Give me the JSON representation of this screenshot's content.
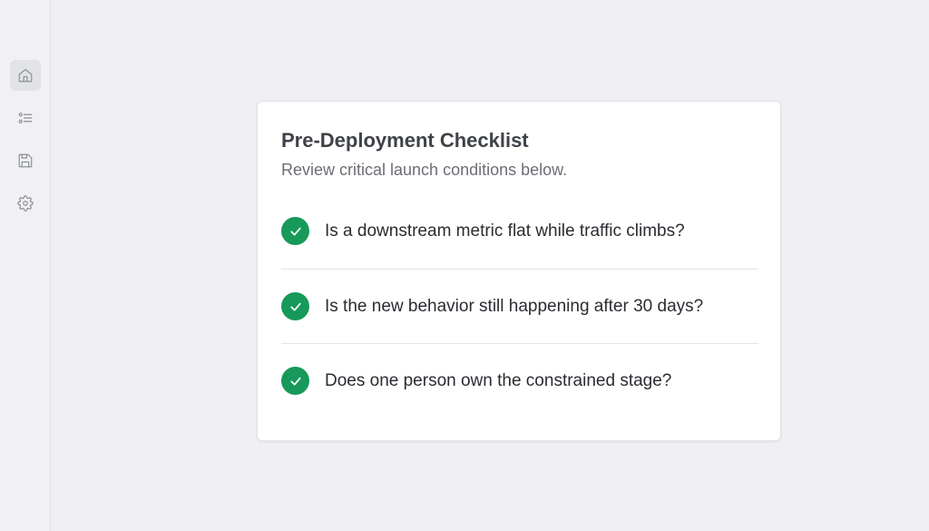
{
  "sidebar": {
    "items": [
      {
        "icon": "home-icon",
        "active": true
      },
      {
        "icon": "checklist-icon",
        "active": false
      },
      {
        "icon": "save-icon",
        "active": false
      },
      {
        "icon": "gear-icon",
        "active": false
      }
    ]
  },
  "card": {
    "title": "Pre-Deployment Checklist",
    "subtitle": "Review critical launch conditions below.",
    "items": [
      {
        "text": "Is a downstream metric flat while traffic climbs?",
        "checked": true
      },
      {
        "text": "Is the new behavior still happening after 30 days?",
        "checked": true
      },
      {
        "text": "Does one person own the constrained stage?",
        "checked": true
      }
    ]
  },
  "colors": {
    "check_green": "#17995a",
    "background": "#f0f0f3",
    "card": "#ffffff"
  }
}
